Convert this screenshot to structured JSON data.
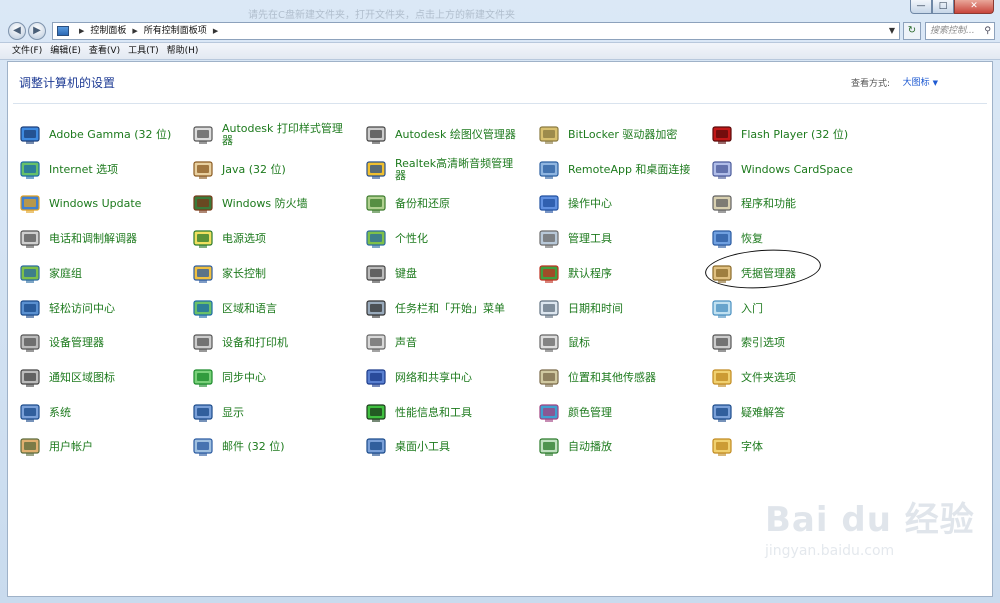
{
  "window": {
    "ghost_title": "请先在C盘新建文件夹，打开文件夹，点击上方的新建文件夹",
    "buttons": {
      "minimize": "—",
      "maximize": "□",
      "close": "✕"
    }
  },
  "nav": {
    "back": "◀",
    "forward": "▶",
    "breadcrumb": [
      "控制面板",
      "所有控制面板项"
    ],
    "refresh": "↻",
    "search_placeholder": "搜索控制..."
  },
  "menu": [
    "文件(F)",
    "编辑(E)",
    "查看(V)",
    "工具(T)",
    "帮助(H)"
  ],
  "page": {
    "title": "调整计算机的设置",
    "view_by_label": "查看方式:",
    "view_by_value": "大图标"
  },
  "items": [
    {
      "label": "Adobe Gamma (32 位)",
      "icon": "monitor-icon"
    },
    {
      "label": "Autodesk 打印样式管理器",
      "icon": "printer-icon"
    },
    {
      "label": "Autodesk 绘图仪管理器",
      "icon": "plotter-icon"
    },
    {
      "label": "BitLocker 驱动器加密",
      "icon": "key-icon"
    },
    {
      "label": "Flash Player (32 位)",
      "icon": "flash-icon"
    },
    {
      "label": "Internet 选项",
      "icon": "globe-icon"
    },
    {
      "label": "Java (32 位)",
      "icon": "java-icon"
    },
    {
      "label": "Realtek高清晰音频管理器",
      "icon": "audio-icon"
    },
    {
      "label": "RemoteApp 和桌面连接",
      "icon": "remote-icon"
    },
    {
      "label": "Windows CardSpace",
      "icon": "cardspace-icon"
    },
    {
      "label": "Windows Update",
      "icon": "update-icon"
    },
    {
      "label": "Windows 防火墙",
      "icon": "firewall-icon"
    },
    {
      "label": "备份和还原",
      "icon": "backup-icon"
    },
    {
      "label": "操作中心",
      "icon": "flag-icon"
    },
    {
      "label": "程序和功能",
      "icon": "programs-icon"
    },
    {
      "label": "电话和调制解调器",
      "icon": "phone-icon"
    },
    {
      "label": "电源选项",
      "icon": "power-icon"
    },
    {
      "label": "个性化",
      "icon": "personalize-icon"
    },
    {
      "label": "管理工具",
      "icon": "tools-icon"
    },
    {
      "label": "恢复",
      "icon": "recovery-icon"
    },
    {
      "label": "家庭组",
      "icon": "homegroup-icon"
    },
    {
      "label": "家长控制",
      "icon": "parental-icon"
    },
    {
      "label": "键盘",
      "icon": "keyboard-icon"
    },
    {
      "label": "默认程序",
      "icon": "default-programs-icon"
    },
    {
      "label": "凭据管理器",
      "icon": "credential-icon"
    },
    {
      "label": "轻松访问中心",
      "icon": "access-icon"
    },
    {
      "label": "区域和语言",
      "icon": "region-icon"
    },
    {
      "label": "任务栏和「开始」菜单",
      "icon": "taskbar-icon"
    },
    {
      "label": "日期和时间",
      "icon": "clock-icon"
    },
    {
      "label": "入门",
      "icon": "getting-started-icon"
    },
    {
      "label": "设备管理器",
      "icon": "device-manager-icon"
    },
    {
      "label": "设备和打印机",
      "icon": "devices-printers-icon"
    },
    {
      "label": "声音",
      "icon": "speaker-icon"
    },
    {
      "label": "鼠标",
      "icon": "mouse-icon"
    },
    {
      "label": "索引选项",
      "icon": "index-icon"
    },
    {
      "label": "通知区域图标",
      "icon": "notification-icon"
    },
    {
      "label": "同步中心",
      "icon": "sync-icon"
    },
    {
      "label": "网络和共享中心",
      "icon": "network-icon"
    },
    {
      "label": "位置和其他传感器",
      "icon": "sensor-icon"
    },
    {
      "label": "文件夹选项",
      "icon": "folder-icon"
    },
    {
      "label": "系统",
      "icon": "system-icon"
    },
    {
      "label": "显示",
      "icon": "display-icon"
    },
    {
      "label": "性能信息和工具",
      "icon": "performance-icon"
    },
    {
      "label": "颜色管理",
      "icon": "color-icon"
    },
    {
      "label": "疑难解答",
      "icon": "troubleshoot-icon"
    },
    {
      "label": "用户帐户",
      "icon": "users-icon"
    },
    {
      "label": "邮件 (32 位)",
      "icon": "mail-icon"
    },
    {
      "label": "桌面小工具",
      "icon": "gadgets-icon"
    },
    {
      "label": "自动播放",
      "icon": "autoplay-icon"
    },
    {
      "label": "字体",
      "icon": "font-icon"
    }
  ],
  "colors": {
    "link_green": "#1d7a1d",
    "title_blue": "#1e3b94",
    "view_blue": "#1e5ad2"
  },
  "watermark": {
    "line1": "Bai du 经验",
    "line2": "jingyan.baidu.com"
  }
}
